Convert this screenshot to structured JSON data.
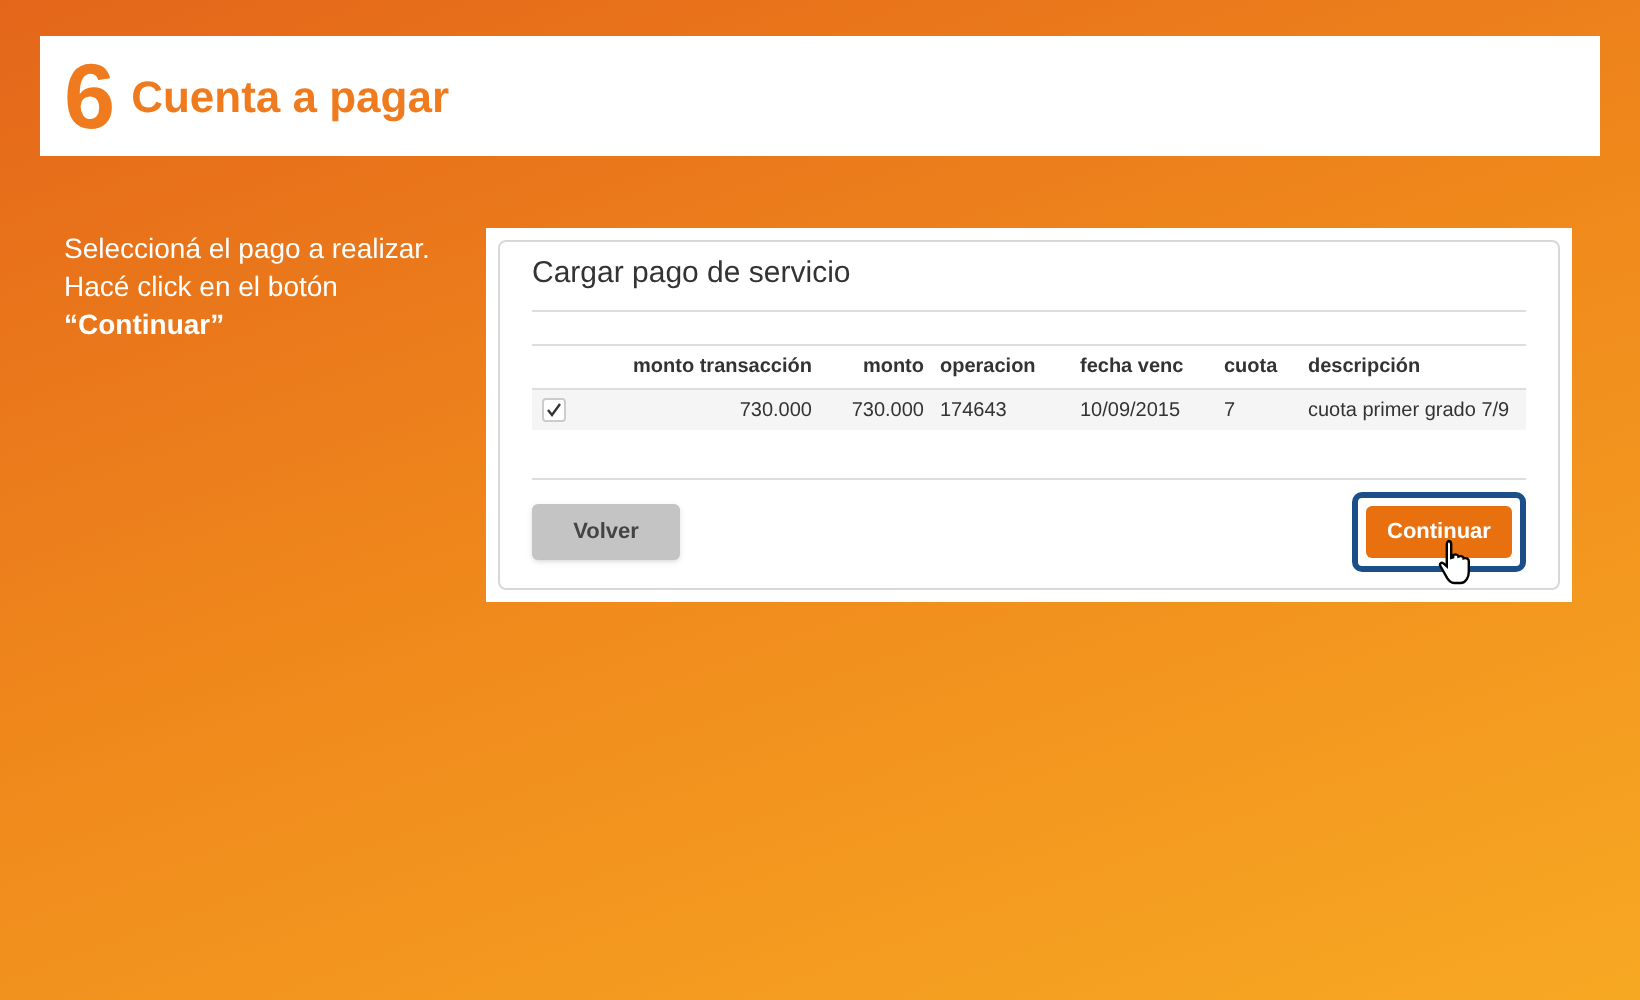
{
  "step": {
    "number": "6",
    "title": "Cuenta a pagar"
  },
  "instructions": "Seleccioná el pago a realizar. Hacé click en el botón **“Continuar”**",
  "form": {
    "title": "Cargar pago de servicio",
    "columns": [
      "monto transacción",
      "monto",
      "operacion",
      "fecha venc",
      "cuota",
      "descripción"
    ],
    "rows": [
      {
        "checked": true,
        "cells": [
          "730.000",
          "730.000",
          "174643",
          "10/09/2015",
          "7",
          "cuota primer grado 7/9"
        ]
      }
    ],
    "back_button": "Volver",
    "continue_button": {
      "label": "Continuar",
      "highlighted": true
    }
  }
}
